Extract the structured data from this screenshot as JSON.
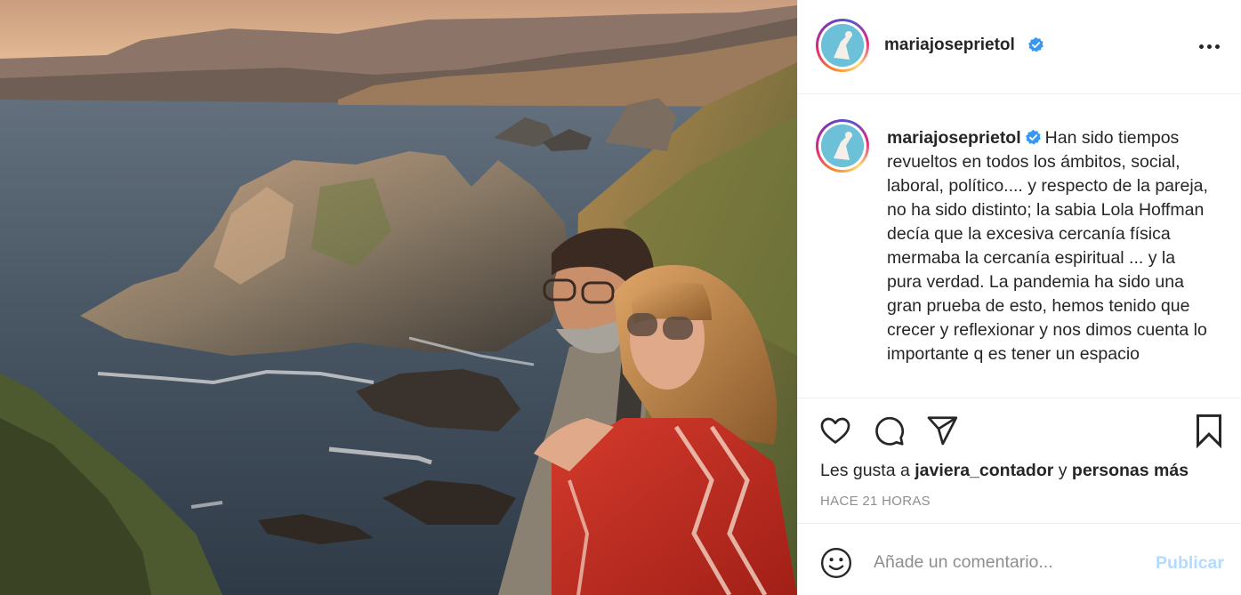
{
  "post": {
    "photo_alt": "",
    "author": {
      "username": "mariajoseprietol",
      "verified": true
    },
    "header_icons": {
      "verified": "verified-badge-icon",
      "more": "more-options-icon"
    },
    "caption": {
      "username": "mariajoseprietol",
      "text": "Han sido tiempos revueltos en todos los ámbitos, social, laboral, político.... y respecto de la pareja, no ha sido distinto; la sabia Lola Hoffman decía que la excesiva cercanía física mermaba la cercanía espiritual ... y la pura verdad. La pandemia ha sido una gran prueba de esto, hemos tenido que crecer y reflexionar y nos dimos cuenta lo importante q es tener un espacio"
    },
    "actions": {
      "like": "heart-icon",
      "comment": "comment-bubble-icon",
      "share": "paper-plane-icon",
      "save": "bookmark-icon"
    },
    "likes": {
      "prefix": "Les gusta a",
      "user": "javiera_contador",
      "conjunction": "y",
      "others": "personas más"
    },
    "timestamp": "HACE 21 HORAS",
    "comment_box": {
      "placeholder": "Añade un comentario...",
      "submit_label": "Publicar",
      "emoji": "emoji-smiley-icon"
    },
    "colors": {
      "text": "#262626",
      "secondary": "#8e8e8e",
      "link_disabled": "#b3dbff",
      "verified": "#3897f0",
      "border": "#efefef"
    }
  }
}
